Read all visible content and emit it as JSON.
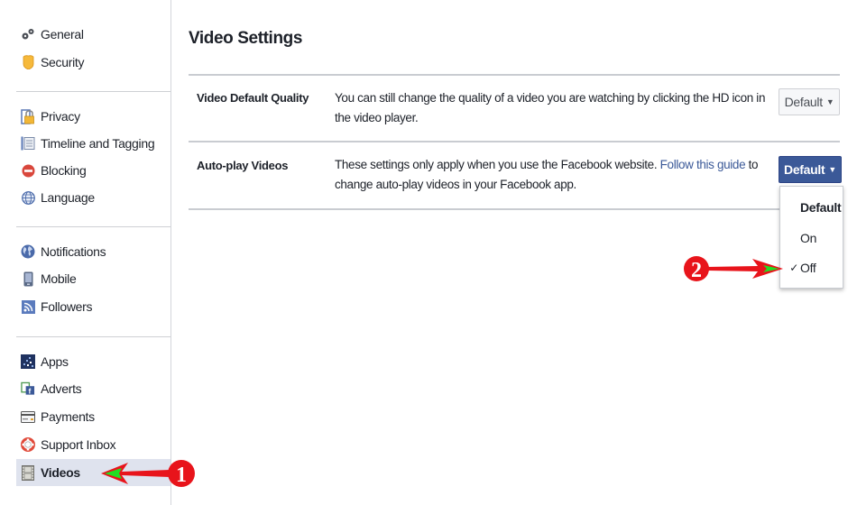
{
  "sidebar": {
    "groups": [
      [
        {
          "label": "General",
          "icon": "gears-icon"
        },
        {
          "label": "Security",
          "icon": "shield-badge-icon"
        }
      ],
      [
        {
          "label": "Privacy",
          "icon": "padlock-icon"
        },
        {
          "label": "Timeline and Tagging",
          "icon": "timeline-icon"
        },
        {
          "label": "Blocking",
          "icon": "blocking-icon"
        },
        {
          "label": "Language",
          "icon": "globe-icon"
        }
      ],
      [
        {
          "label": "Notifications",
          "icon": "earth-icon"
        },
        {
          "label": "Mobile",
          "icon": "mobile-phone-icon"
        },
        {
          "label": "Followers",
          "icon": "rss-icon"
        }
      ],
      [
        {
          "label": "Apps",
          "icon": "apps-icon"
        },
        {
          "label": "Adverts",
          "icon": "adverts-icon"
        },
        {
          "label": "Payments",
          "icon": "credit-card-icon"
        },
        {
          "label": "Support Inbox",
          "icon": "lifebuoy-icon"
        },
        {
          "label": "Videos",
          "icon": "film-strip-icon",
          "active": true
        }
      ]
    ]
  },
  "main": {
    "title": "Video Settings",
    "rows": [
      {
        "label": "Video Default Quality",
        "description": "You can still change the quality of a video you are watching by clicking the HD icon in the video player.",
        "button": "Default"
      },
      {
        "label": "Auto-play Videos",
        "description_before": "These settings only apply when you use the Facebook website. ",
        "link": "Follow this guide",
        "description_after": " to change auto-play videos in your Facebook app.",
        "button": "Default"
      }
    ],
    "dropdown": {
      "options": [
        {
          "label": "Default",
          "selected": false,
          "bold": true
        },
        {
          "label": "On",
          "selected": false
        },
        {
          "label": "Off",
          "selected": true
        }
      ],
      "check_glyph": "✓"
    }
  },
  "annotations": {
    "marker_1": "1",
    "marker_2": "2",
    "arrow_color": "#e8141b",
    "arrow_tip_color": "#22dd22"
  },
  "colors": {
    "brand_blue": "#3b5998",
    "active_bg": "#dfe3ee"
  }
}
